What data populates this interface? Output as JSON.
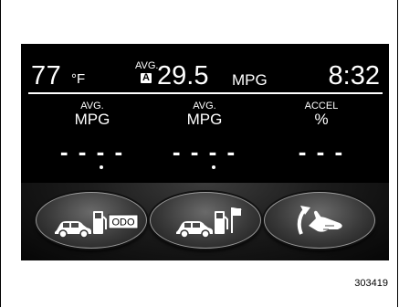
{
  "status": {
    "temperature": "77",
    "temperature_unit": "°F",
    "avg_label": "AVG.",
    "avg_badge": "A",
    "mpg_value": "29.5",
    "mpg_unit": "MPG",
    "clock": "8:32"
  },
  "columns": [
    {
      "label_top": "AVG.",
      "label_bottom": "MPG",
      "value": "- - - -"
    },
    {
      "label_top": "AVG.",
      "label_bottom": "MPG",
      "value": "- - - -"
    },
    {
      "label_top": "ACCEL",
      "label_bottom": "%",
      "value": "- - -"
    }
  ],
  "buttons": [
    {
      "icon": "car-fuel-odo-icon",
      "odo_label": "ODO"
    },
    {
      "icon": "car-fuel-flag-icon"
    },
    {
      "icon": "hand-accelerate-icon"
    }
  ],
  "figure_number": "303419",
  "colors": {
    "screen_bg": "#000000",
    "text": "#ffffff",
    "button": "#4a4a4a"
  }
}
